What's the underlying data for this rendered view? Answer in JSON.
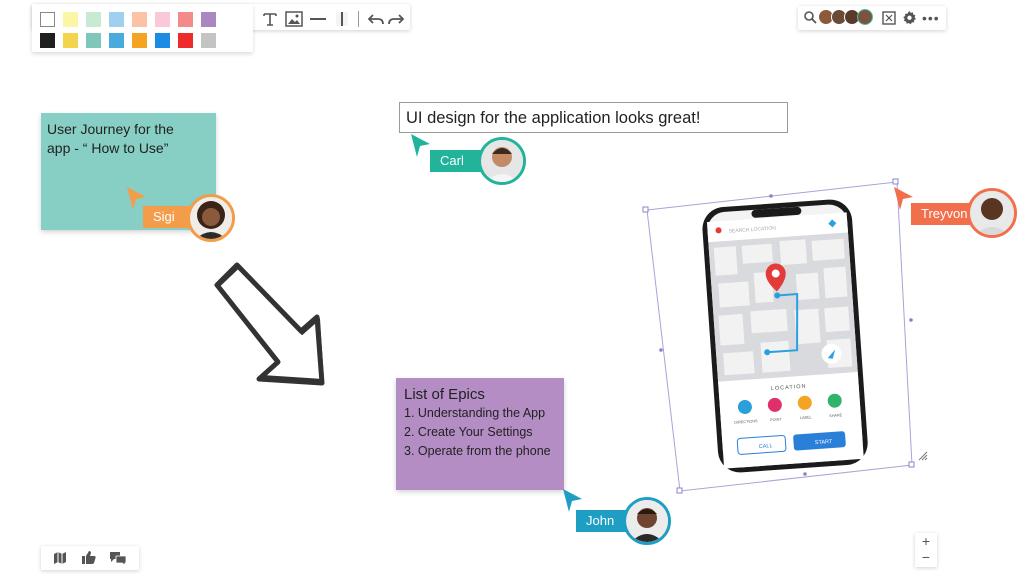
{
  "toolbar": {
    "swatches_row1": [
      "#ffffff",
      "#fdf5a6",
      "#c9ead2",
      "#9fd0ee",
      "#fcc2a6",
      "#fbc8d7",
      "#f38b8b",
      "#ab87c1"
    ],
    "swatches_row2": [
      "#1f1f1f",
      "#f2d54c",
      "#80c7bb",
      "#4aa9dd",
      "#f5a323",
      "#1a8ce5",
      "#ee2b2b",
      "#c4c4c4"
    ],
    "tools": [
      "collapse-icon",
      "text-icon",
      "image-icon",
      "horizontal-line-icon",
      "vertical-line-icon",
      "undo-icon",
      "redo-icon"
    ]
  },
  "topbar": {
    "icons": [
      "search-icon",
      "fit-screen-icon",
      "settings-icon",
      "more-icon"
    ]
  },
  "sticky_teal": {
    "text_line1": "User Journey for the",
    "text_line2": "app - “ How to Use”"
  },
  "textbox": {
    "text": "UI design for the application looks great!"
  },
  "sticky_purple": {
    "title": "List of Epics",
    "items": [
      "1. Understanding the App",
      "2. Create Your Settings",
      "3. Operate from the phone"
    ]
  },
  "cursors": {
    "sigi": {
      "name": "Sigi",
      "color": "#f39c4a"
    },
    "carl": {
      "name": "Carl",
      "color": "#21b49b"
    },
    "treyvon": {
      "name": "Treyvon",
      "color": "#f26f4b"
    },
    "john": {
      "name": "John",
      "color": "#1f9ec4"
    }
  },
  "phone": {
    "search_placeholder": "SEARCH LOCATION",
    "section_label": "LOCATION",
    "actions": [
      "DIRECTIONS",
      "POINT",
      "LABEL",
      "SHARE"
    ],
    "call_label": "CALL",
    "start_label": "START"
  },
  "bottom_left": {
    "icons": [
      "map-icon",
      "thumbs-up-icon",
      "chat-icon"
    ]
  },
  "zoom": {
    "in": "+",
    "out": "−"
  }
}
